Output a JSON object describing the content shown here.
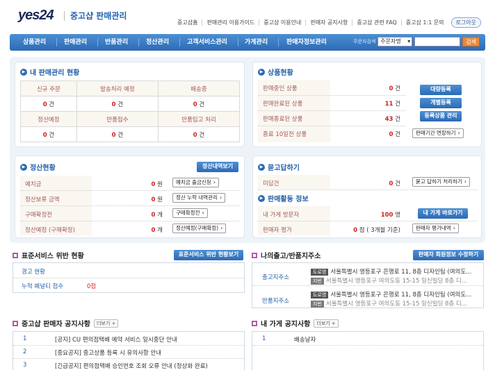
{
  "header": {
    "logo": "yes24",
    "title": "중고샵 판매관리",
    "links": [
      "중고샵홈",
      "판매관리 이용가이드",
      "중고샵 이용안내",
      "판매자 공지사항",
      "중고샵 관련 FAQ",
      "중고샵 1:1 문의"
    ],
    "logout": "로그아웃"
  },
  "menu": {
    "items": [
      "상품관리",
      "판매관리",
      "반품관리",
      "정산관리",
      "고객서비스관리",
      "가게관리",
      "판매자정보관리"
    ],
    "search_label": "주문자검색",
    "search_select": "주문자명",
    "search_button": "검색"
  },
  "sales_status": {
    "title": "내 판매관리 현황",
    "row1_headers": [
      "신규 주문",
      "발송처리 예정",
      "배송중"
    ],
    "row1_values": [
      "0",
      "0",
      "0"
    ],
    "row2_headers": [
      "정산예정",
      "반품접수",
      "반품입고 처리"
    ],
    "row2_values": [
      "0",
      "0",
      "0"
    ],
    "unit": "건"
  },
  "product_status": {
    "title": "상품현황",
    "rows": [
      {
        "label": "판매중인 상품",
        "value": "0",
        "unit": "건"
      },
      {
        "label": "판매완료된 상품",
        "value": "11",
        "unit": "건"
      },
      {
        "label": "판매종료된 상품",
        "value": "43",
        "unit": "건"
      },
      {
        "label": "종료 10일전 상품",
        "value": "0",
        "unit": "건"
      }
    ],
    "buttons": [
      "대량등록",
      "개별등록",
      "등록상품 관리"
    ],
    "extend_button": "판매기간 연장하기"
  },
  "settlement": {
    "title": "정산현황",
    "button": "정산내역보기",
    "rows": [
      {
        "label": "예치금",
        "value": "0",
        "unit": "원",
        "action": "예치금 출금신청"
      },
      {
        "label": "정산보류 금액",
        "value": "0",
        "unit": "원",
        "action": "정산 누락 내역관리"
      },
      {
        "label": "구매확정전",
        "value": "0",
        "unit": "개",
        "action": "구매확정전"
      },
      {
        "label": "정산예정 (구매확정)",
        "value": "0",
        "unit": "개",
        "action": "정산예정(구매확정)"
      }
    ]
  },
  "qna": {
    "title": "묻고답하기",
    "label": "미답건",
    "value": "0",
    "unit": "건",
    "action": "묻고 답하기 처리하기"
  },
  "activity": {
    "title": "판매활동 정보",
    "visitors_label": "내 가게 방문자",
    "visitors_value": "100",
    "visitors_unit": "명",
    "visitors_button": "내 가게 바로가기",
    "rating_label": "판매자 평가",
    "rating_value": "0",
    "rating_suffix": "점 ( 3개월 기준)",
    "rating_button": "판매자 평가내역"
  },
  "violation": {
    "title": "표준서비스 위반 현황",
    "button": "표준서비스 위반 현황보기",
    "rows": [
      {
        "label": "경고 현황",
        "value": ""
      },
      {
        "label": "누적 페널티 점수",
        "value": "0점"
      }
    ]
  },
  "address": {
    "title": "나의출고/반품지주소",
    "button": "판매자 회원정보 수정하기",
    "ship_label": "출고지주소",
    "return_label": "반품지주소",
    "road_tag": "도로명",
    "lot_tag": "지번",
    "road_addr": "서울특별시 영등포구 은행로 11, 8층 디자인팀 (여의도...",
    "lot_addr": "서울특별시 영등포구 여의도동 15-15 일신빌딩 8층 디..."
  },
  "notice": {
    "title": "중고샵 판매자 공지사항",
    "more": "더보기 +",
    "items": [
      {
        "num": "1",
        "text": "[공지] CU 편의점택배 예약 서비스 일시중단 안내"
      },
      {
        "num": "2",
        "text": "[중요공지] 중고상품 등록 시 유의사항 안내"
      },
      {
        "num": "3",
        "text": "[긴급공지] 편의점택배 승인번호 조회 오류 안내 (정상화 완료)"
      }
    ]
  },
  "store_notice": {
    "title": "내 가게 공지사항",
    "more": "더보기 +",
    "items": [
      {
        "num": "1",
        "text": "배송날자"
      }
    ]
  }
}
